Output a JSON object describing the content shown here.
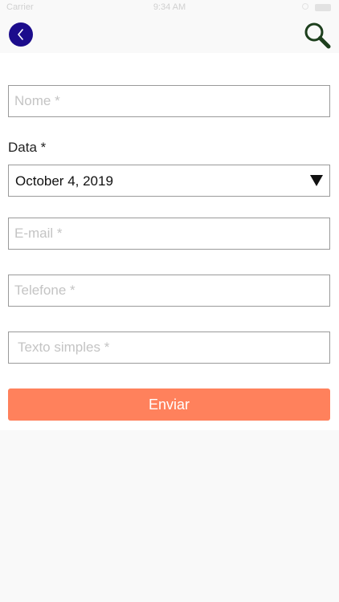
{
  "status_bar": {
    "carrier": "Carrier",
    "time": "9:34 AM"
  },
  "nav": {
    "back_icon": "chevron-left-icon",
    "search_icon": "magnifier-icon",
    "back_color": "#1c0c8c",
    "search_color": "#1d3f1d"
  },
  "form": {
    "name_placeholder": "Nome *",
    "date_label": "Data *",
    "date_value": "October 4, 2019",
    "email_placeholder": "E-mail *",
    "phone_placeholder": "Telefone *",
    "text_placeholder": "Texto simples *",
    "submit_label": "Enviar",
    "submit_color": "#ff815c"
  }
}
